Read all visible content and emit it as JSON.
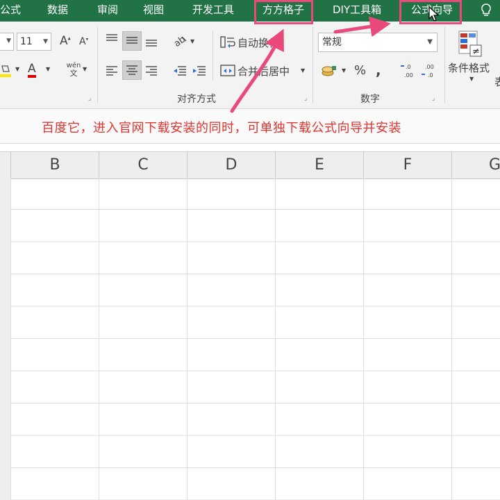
{
  "ribbon_tabs": {
    "formula": "公式",
    "data": "数据",
    "review": "审阅",
    "view": "视图",
    "developer": "开发工具",
    "fangfang": "方方格子",
    "diy": "DIY工具箱",
    "formula_wizard": "公式向导"
  },
  "font": {
    "size": "11",
    "grow_icon": "A↑",
    "shrink_icon": "A↓",
    "font_color_icon": "A",
    "fill_color_icon": "paint-bucket-icon",
    "phonetic": "wén 文"
  },
  "alignment": {
    "wrap_text": "自动换行",
    "merge_center": "合并后居中",
    "group_label": "对齐方式"
  },
  "number": {
    "format": "常规",
    "percent": "%",
    "comma": ",",
    "group_label": "数字"
  },
  "styles": {
    "conditional_format": "条件格式"
  },
  "annotation": "百度它，进入官网下载安装的同时，可单独下载公式向导并安装",
  "columns": [
    "B",
    "C",
    "D",
    "E",
    "F",
    "G"
  ],
  "colors": {
    "ribbon_green": "#217346",
    "highlight": "#e94a7b",
    "annotation_red": "#e0342f"
  }
}
